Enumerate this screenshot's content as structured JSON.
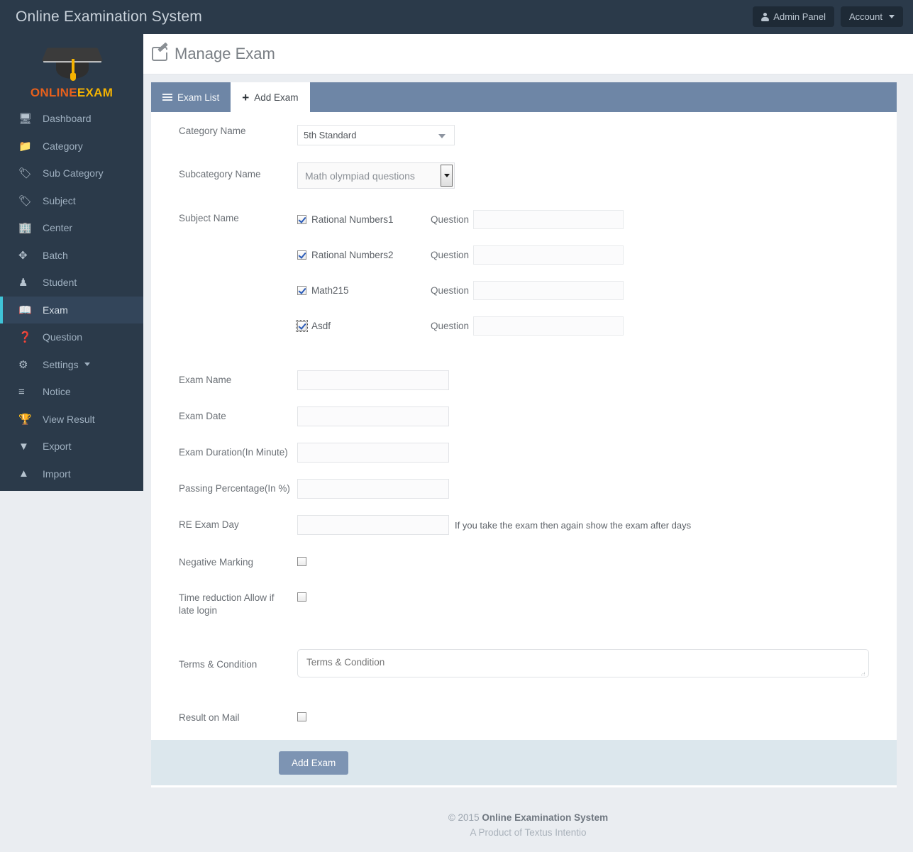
{
  "topbar": {
    "brand": "Online Examination System",
    "admin_button": "Admin Panel",
    "account_button": "Account"
  },
  "sidebar": {
    "logo_first": "ONLINE",
    "logo_second": "EXAM",
    "items": [
      {
        "label": "Dashboard",
        "icon": "monitor-icon",
        "active": false
      },
      {
        "label": "Category",
        "icon": "folder-icon",
        "active": false
      },
      {
        "label": "Sub Category",
        "icon": "tags-icon",
        "active": false
      },
      {
        "label": "Subject",
        "icon": "tag-icon",
        "active": false
      },
      {
        "label": "Center",
        "icon": "building-icon",
        "active": false
      },
      {
        "label": "Batch",
        "icon": "arrows-icon",
        "active": false
      },
      {
        "label": "Student",
        "icon": "person-icon",
        "active": false
      },
      {
        "label": "Exam",
        "icon": "book-icon",
        "active": true
      },
      {
        "label": "Question",
        "icon": "question-icon",
        "active": false
      },
      {
        "label": "Settings",
        "icon": "gears-icon",
        "active": false
      },
      {
        "label": "Notice",
        "icon": "list-icon",
        "active": false
      },
      {
        "label": "View Result",
        "icon": "trophy-icon",
        "active": false
      },
      {
        "label": "Export",
        "icon": "download-icon",
        "active": false
      },
      {
        "label": "Import",
        "icon": "upload-icon",
        "active": false
      }
    ]
  },
  "page": {
    "title": "Manage Exam",
    "title_icon": "edit-pencil-icon"
  },
  "tabs": [
    {
      "label": "Exam List",
      "icon": "list-icon",
      "active": false
    },
    {
      "label": "Add Exam",
      "icon": "plus-icon",
      "active": true
    }
  ],
  "form": {
    "category": {
      "label": "Category Name",
      "value": "5th Standard"
    },
    "subcategory": {
      "label": "Subcategory Name",
      "value": "Math olympiad questions"
    },
    "subject": {
      "label": "Subject Name",
      "question_label": "Question",
      "rows": [
        {
          "name": "Rational Numbers1",
          "checked": true,
          "focused": false,
          "question": ""
        },
        {
          "name": "Rational Numbers2",
          "checked": true,
          "focused": false,
          "question": ""
        },
        {
          "name": "Math215",
          "checked": true,
          "focused": false,
          "question": ""
        },
        {
          "name": "Asdf",
          "checked": true,
          "focused": true,
          "question": ""
        }
      ]
    },
    "exam_name": {
      "label": "Exam Name",
      "value": ""
    },
    "exam_date": {
      "label": "Exam Date",
      "value": ""
    },
    "exam_duration": {
      "label": "Exam Duration(In Minute)",
      "value": ""
    },
    "passing_pct": {
      "label": "Passing Percentage(In %)",
      "value": ""
    },
    "re_exam_day": {
      "label": "RE Exam Day",
      "value": "",
      "hint": "If you take the exam then again show the exam after days"
    },
    "negative_marking": {
      "label": "Negative Marking",
      "checked": false
    },
    "time_reduction": {
      "label": "Time reduction Allow if late login",
      "checked": false
    },
    "terms": {
      "label": "Terms & Condition",
      "placeholder": "Terms & Condition",
      "value": ""
    },
    "result_on_mail": {
      "label": "Result on Mail",
      "checked": false
    },
    "submit_button": "Add Exam"
  },
  "footer": {
    "copy_prefix": "© 2015 ",
    "copy_name": "Online Examination System",
    "product_line": "A Product of Textus Intentio"
  },
  "colors": {
    "topbar_bg": "#2b3a4a",
    "sidebar_bg": "#2b3a4a",
    "active_accent": "#3fc4d8",
    "tab_bar": "#6e86a6",
    "submit_btn": "#7d94b3",
    "footer_bar": "#dce7ed",
    "logo_orange": "#e8601c",
    "logo_yellow": "#f5b301",
    "page_bg": "#eaedf1"
  }
}
